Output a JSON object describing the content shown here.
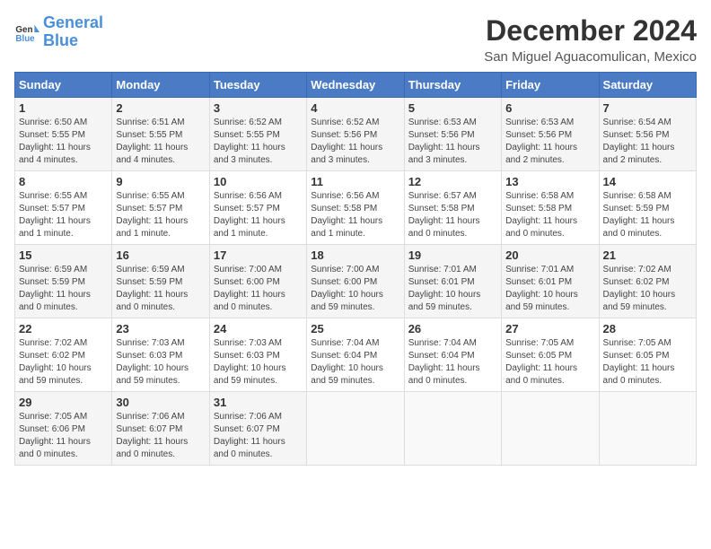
{
  "logo": {
    "line1": "General",
    "line2": "Blue"
  },
  "title": "December 2024",
  "subtitle": "San Miguel Aguacomulican, Mexico",
  "days_of_week": [
    "Sunday",
    "Monday",
    "Tuesday",
    "Wednesday",
    "Thursday",
    "Friday",
    "Saturday"
  ],
  "weeks": [
    [
      {
        "day": "1",
        "info": "Sunrise: 6:50 AM\nSunset: 5:55 PM\nDaylight: 11 hours\nand 4 minutes."
      },
      {
        "day": "2",
        "info": "Sunrise: 6:51 AM\nSunset: 5:55 PM\nDaylight: 11 hours\nand 4 minutes."
      },
      {
        "day": "3",
        "info": "Sunrise: 6:52 AM\nSunset: 5:55 PM\nDaylight: 11 hours\nand 3 minutes."
      },
      {
        "day": "4",
        "info": "Sunrise: 6:52 AM\nSunset: 5:56 PM\nDaylight: 11 hours\nand 3 minutes."
      },
      {
        "day": "5",
        "info": "Sunrise: 6:53 AM\nSunset: 5:56 PM\nDaylight: 11 hours\nand 3 minutes."
      },
      {
        "day": "6",
        "info": "Sunrise: 6:53 AM\nSunset: 5:56 PM\nDaylight: 11 hours\nand 2 minutes."
      },
      {
        "day": "7",
        "info": "Sunrise: 6:54 AM\nSunset: 5:56 PM\nDaylight: 11 hours\nand 2 minutes."
      }
    ],
    [
      {
        "day": "8",
        "info": "Sunrise: 6:55 AM\nSunset: 5:57 PM\nDaylight: 11 hours\nand 1 minute."
      },
      {
        "day": "9",
        "info": "Sunrise: 6:55 AM\nSunset: 5:57 PM\nDaylight: 11 hours\nand 1 minute."
      },
      {
        "day": "10",
        "info": "Sunrise: 6:56 AM\nSunset: 5:57 PM\nDaylight: 11 hours\nand 1 minute."
      },
      {
        "day": "11",
        "info": "Sunrise: 6:56 AM\nSunset: 5:58 PM\nDaylight: 11 hours\nand 1 minute."
      },
      {
        "day": "12",
        "info": "Sunrise: 6:57 AM\nSunset: 5:58 PM\nDaylight: 11 hours\nand 0 minutes."
      },
      {
        "day": "13",
        "info": "Sunrise: 6:58 AM\nSunset: 5:58 PM\nDaylight: 11 hours\nand 0 minutes."
      },
      {
        "day": "14",
        "info": "Sunrise: 6:58 AM\nSunset: 5:59 PM\nDaylight: 11 hours\nand 0 minutes."
      }
    ],
    [
      {
        "day": "15",
        "info": "Sunrise: 6:59 AM\nSunset: 5:59 PM\nDaylight: 11 hours\nand 0 minutes."
      },
      {
        "day": "16",
        "info": "Sunrise: 6:59 AM\nSunset: 5:59 PM\nDaylight: 11 hours\nand 0 minutes."
      },
      {
        "day": "17",
        "info": "Sunrise: 7:00 AM\nSunset: 6:00 PM\nDaylight: 11 hours\nand 0 minutes."
      },
      {
        "day": "18",
        "info": "Sunrise: 7:00 AM\nSunset: 6:00 PM\nDaylight: 10 hours\nand 59 minutes."
      },
      {
        "day": "19",
        "info": "Sunrise: 7:01 AM\nSunset: 6:01 PM\nDaylight: 10 hours\nand 59 minutes."
      },
      {
        "day": "20",
        "info": "Sunrise: 7:01 AM\nSunset: 6:01 PM\nDaylight: 10 hours\nand 59 minutes."
      },
      {
        "day": "21",
        "info": "Sunrise: 7:02 AM\nSunset: 6:02 PM\nDaylight: 10 hours\nand 59 minutes."
      }
    ],
    [
      {
        "day": "22",
        "info": "Sunrise: 7:02 AM\nSunset: 6:02 PM\nDaylight: 10 hours\nand 59 minutes."
      },
      {
        "day": "23",
        "info": "Sunrise: 7:03 AM\nSunset: 6:03 PM\nDaylight: 10 hours\nand 59 minutes."
      },
      {
        "day": "24",
        "info": "Sunrise: 7:03 AM\nSunset: 6:03 PM\nDaylight: 10 hours\nand 59 minutes."
      },
      {
        "day": "25",
        "info": "Sunrise: 7:04 AM\nSunset: 6:04 PM\nDaylight: 10 hours\nand 59 minutes."
      },
      {
        "day": "26",
        "info": "Sunrise: 7:04 AM\nSunset: 6:04 PM\nDaylight: 11 hours\nand 0 minutes."
      },
      {
        "day": "27",
        "info": "Sunrise: 7:05 AM\nSunset: 6:05 PM\nDaylight: 11 hours\nand 0 minutes."
      },
      {
        "day": "28",
        "info": "Sunrise: 7:05 AM\nSunset: 6:05 PM\nDaylight: 11 hours\nand 0 minutes."
      }
    ],
    [
      {
        "day": "29",
        "info": "Sunrise: 7:05 AM\nSunset: 6:06 PM\nDaylight: 11 hours\nand 0 minutes."
      },
      {
        "day": "30",
        "info": "Sunrise: 7:06 AM\nSunset: 6:07 PM\nDaylight: 11 hours\nand 0 minutes."
      },
      {
        "day": "31",
        "info": "Sunrise: 7:06 AM\nSunset: 6:07 PM\nDaylight: 11 hours\nand 0 minutes."
      },
      {
        "day": "",
        "info": ""
      },
      {
        "day": "",
        "info": ""
      },
      {
        "day": "",
        "info": ""
      },
      {
        "day": "",
        "info": ""
      }
    ]
  ]
}
